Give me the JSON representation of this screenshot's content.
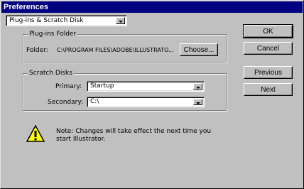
{
  "window": {
    "title": "Preferences"
  },
  "section_select": {
    "value": "Plug-ins & Scratch Disk"
  },
  "plugins_group": {
    "title": "Plug-ins Folder",
    "folder_label": "Folder:",
    "folder_path": "C:\\PROGRAM FILES\\ADOBE\\ILLUSTRATO...",
    "choose_label": "Choose..."
  },
  "scratch_group": {
    "title": "Scratch Disks",
    "primary_label": "Primary:",
    "primary_value": "Startup",
    "secondary_label": "Secondary:",
    "secondary_value": "C:\\"
  },
  "note": {
    "line1": "Note:  Changes will take effect the next time you",
    "line2": "start Illustrator.",
    "icon": "warning-icon"
  },
  "buttons": {
    "ok": "OK",
    "cancel": "Cancel",
    "previous": "Previous",
    "next": "Next"
  }
}
